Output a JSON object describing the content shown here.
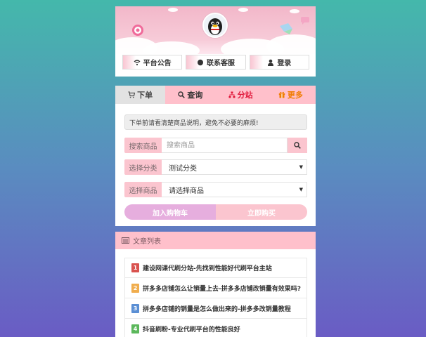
{
  "header": {
    "nav": [
      {
        "label": "平台公告",
        "icon": "wifi-icon"
      },
      {
        "label": "联系客服",
        "icon": "chat-icon"
      },
      {
        "label": "登录",
        "icon": "user-icon"
      }
    ]
  },
  "order": {
    "tabs": [
      {
        "label": "下单",
        "icon": "cart-icon",
        "color": "#444444"
      },
      {
        "label": "查询",
        "icon": "search-icon",
        "color": "#333333"
      },
      {
        "label": "分站",
        "icon": "sitemap-icon",
        "color": "#e0173a"
      },
      {
        "label": "更多",
        "icon": "gift-icon",
        "color": "#f07c00"
      }
    ],
    "notice": "下单前请看清楚商品说明，避免不必要的麻烦!",
    "search_label": "搜索商品",
    "search_placeholder": "搜索商品",
    "category_label": "选择分类",
    "category_value": "测试分类",
    "product_label": "选择商品",
    "product_value": "请选择商品",
    "add_cart_label": "加入购物车",
    "buy_now_label": "立即购买"
  },
  "articles": {
    "title": "文章列表",
    "items": [
      {
        "num": "1",
        "color": "#d9534f",
        "title": "建设网课代刷分站-先找到性能好代刷平台主站"
      },
      {
        "num": "2",
        "color": "#f0ad4e",
        "title": "拼多多店铺怎么让销量上去-拼多多店铺改销量有效果吗?"
      },
      {
        "num": "3",
        "color": "#5b8fd4",
        "title": "拼多多店铺的销量是怎么做出来的-拼多多改销量教程"
      },
      {
        "num": "4",
        "color": "#5cb85c",
        "title": "抖音刷粉-专业代刷平台的性能良好"
      }
    ]
  }
}
